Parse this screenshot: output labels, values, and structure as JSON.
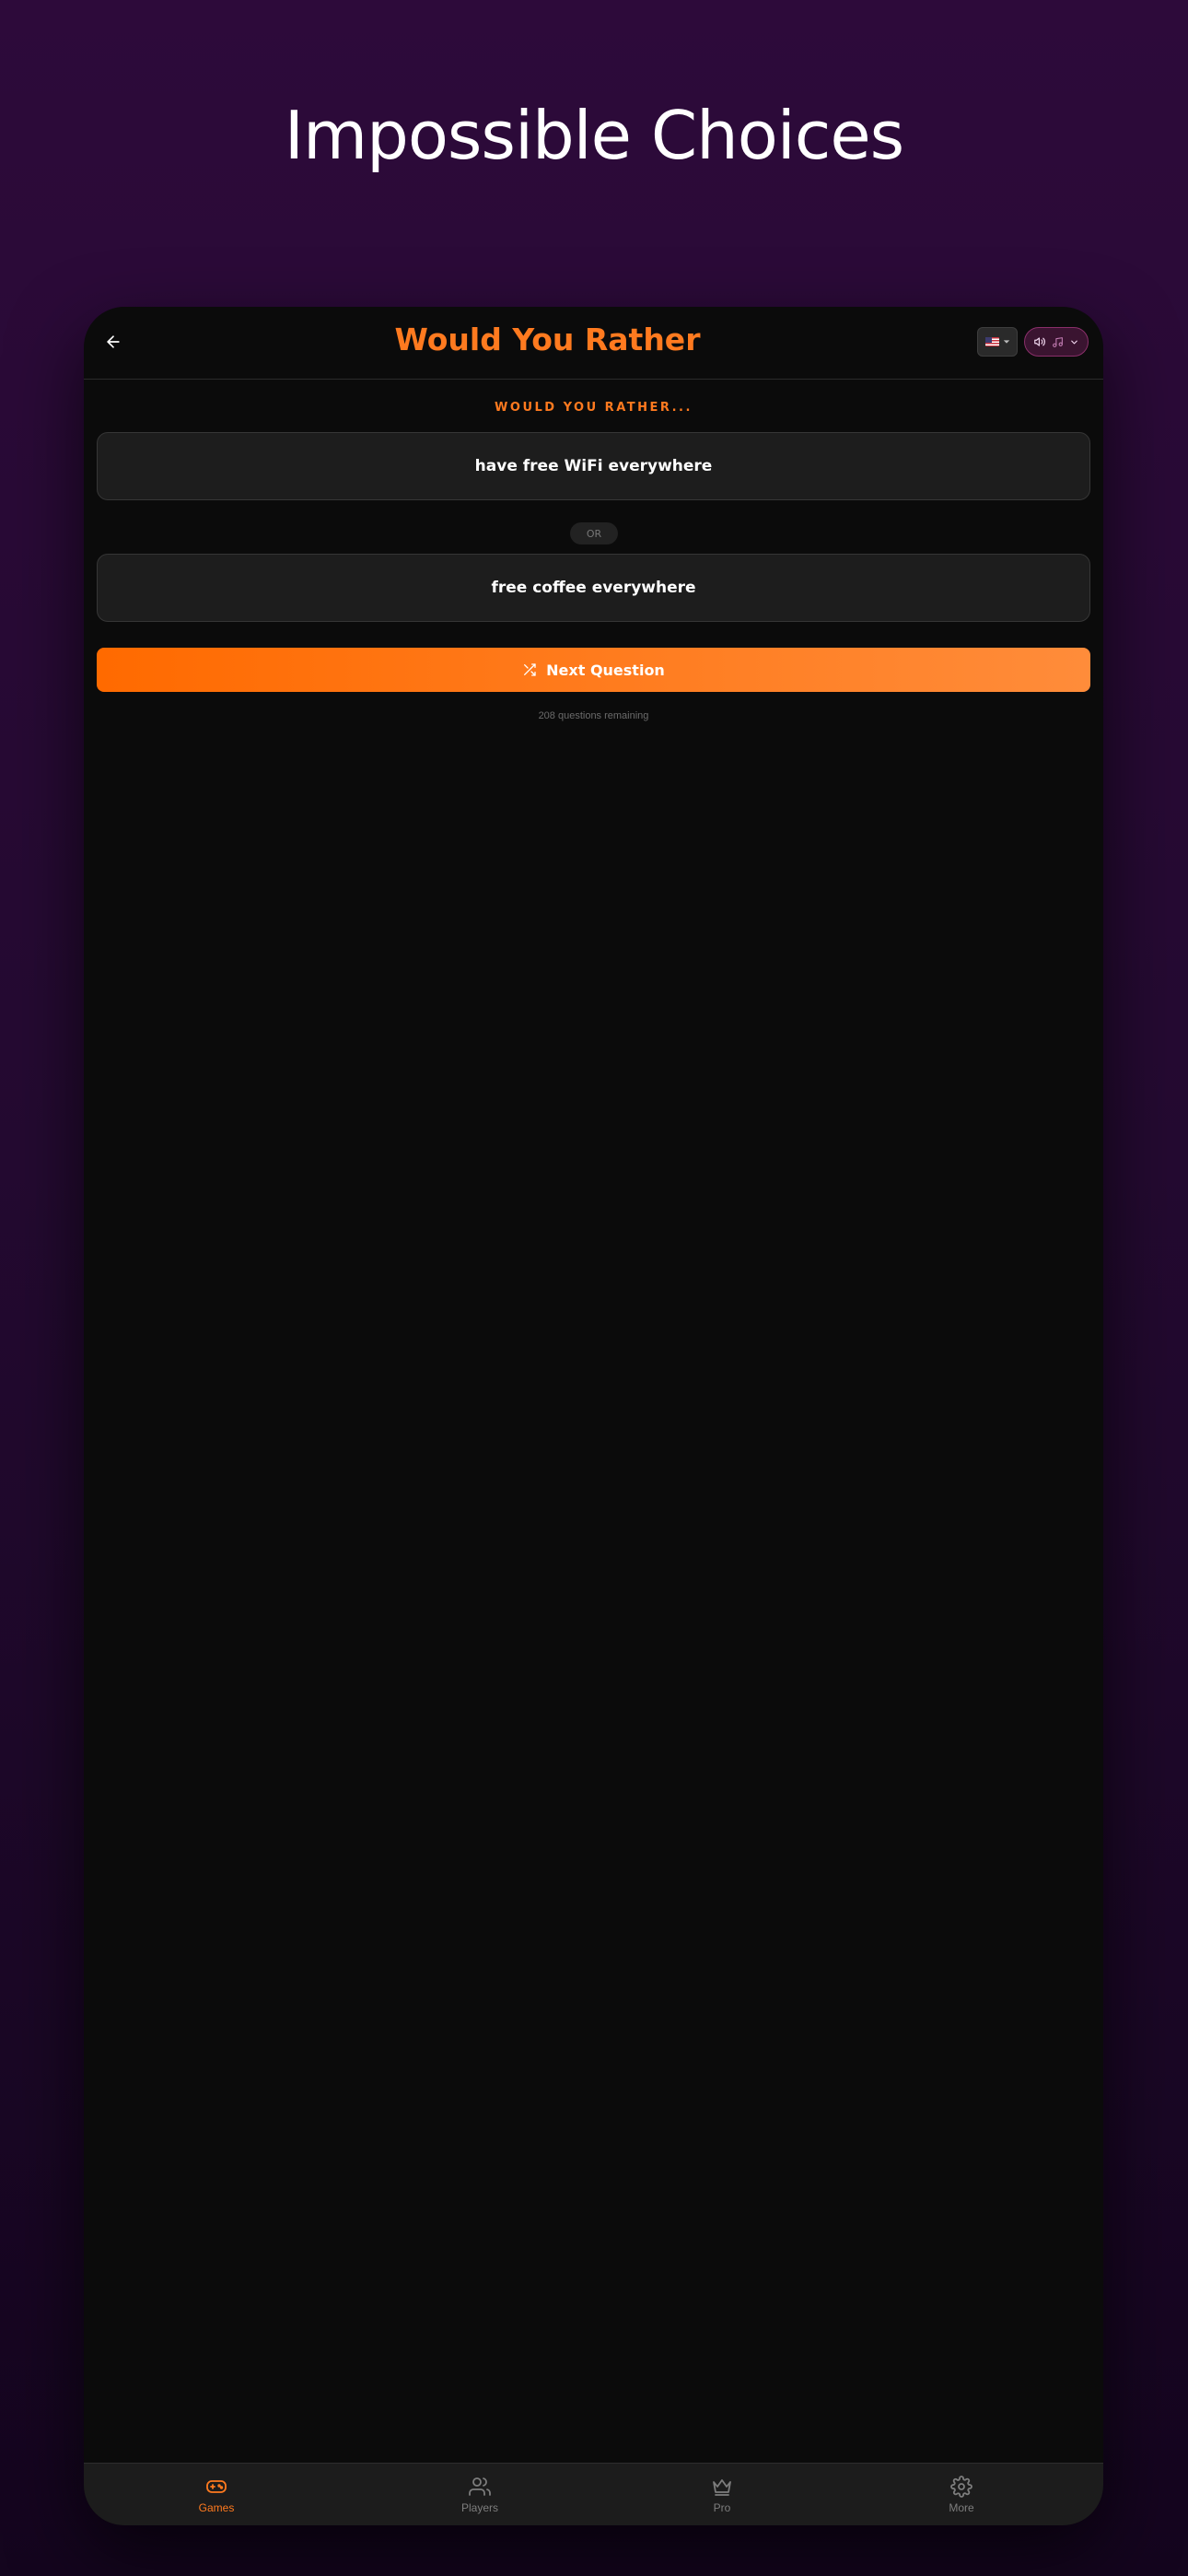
{
  "headline": "Impossible Choices",
  "app": {
    "title": "Would You Rather",
    "prompt": "WOULD YOU RATHER...",
    "option_a": "have free WiFi everywhere",
    "or_label": "OR",
    "option_b": "free coffee everywhere",
    "next_button": "Next Question",
    "remaining": "208 questions remaining"
  },
  "topbar_controls": {
    "language_icon": "us-flag-icon",
    "audio_icons": [
      "speaker-icon",
      "music-note-icon",
      "chevron-down-icon"
    ]
  },
  "nav": {
    "items": [
      {
        "label": "Games",
        "icon": "gamepad-icon",
        "active": true
      },
      {
        "label": "Players",
        "icon": "users-icon",
        "active": false
      },
      {
        "label": "Pro",
        "icon": "crown-icon",
        "active": false
      },
      {
        "label": "More",
        "icon": "gear-icon",
        "active": false
      }
    ]
  },
  "colors": {
    "accent": "#ff7a1f",
    "background_top": "#2d0a3a",
    "background_bottom": "#14051e",
    "card": "#1d1d1d",
    "device": "#0b0b0b"
  }
}
